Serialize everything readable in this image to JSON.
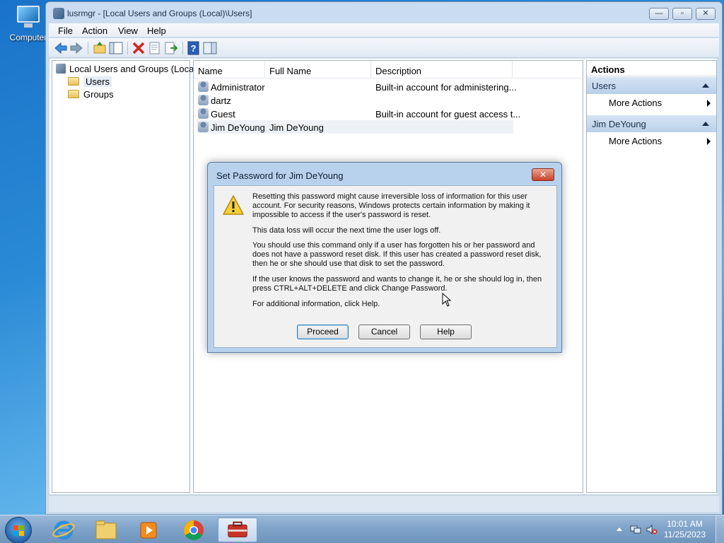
{
  "desktop": {
    "icon_label": "Computer"
  },
  "window": {
    "title": "lusrmgr - [Local Users and Groups (Local)\\Users]",
    "controls": {
      "minimize": "—",
      "maximize": "▫",
      "close": "✕"
    },
    "menu": [
      "File",
      "Action",
      "View",
      "Help"
    ]
  },
  "tree": {
    "root": "Local Users and Groups (Local)",
    "users": "Users",
    "groups": "Groups"
  },
  "list": {
    "columns": [
      "Name",
      "Full Name",
      "Description"
    ],
    "rows": [
      {
        "name": "Administrator",
        "full_name": "",
        "description": "Built-in account for administering..."
      },
      {
        "name": "dartz",
        "full_name": "",
        "description": ""
      },
      {
        "name": "Guest",
        "full_name": "",
        "description": "Built-in account for guest access t..."
      },
      {
        "name": "Jim DeYoung",
        "full_name": "Jim DeYoung",
        "description": ""
      }
    ]
  },
  "actions": {
    "header": "Actions",
    "section1": "Users",
    "section1_item": "More Actions",
    "section2": "Jim DeYoung",
    "section2_item": "More Actions"
  },
  "dialog": {
    "title": "Set Password for Jim DeYoung",
    "close": "✕",
    "p1": "Resetting this password might cause irreversible loss of information for this user account. For security reasons, Windows protects certain information by making it impossible to access if the user's password is reset.",
    "p2": "This data loss will occur the next time the user logs off.",
    "p3": "You should use this command only if a user has forgotten his or her password and does not have a password reset disk. If this user has created a password reset disk, then he or she should use that disk to set the password.",
    "p4": "If the user knows the password and wants to change it, he or she should log in, then press CTRL+ALT+DELETE and click Change Password.",
    "p5": "For additional information, click Help.",
    "buttons": {
      "proceed": "Proceed",
      "cancel": "Cancel",
      "help": "Help"
    }
  },
  "taskbar": {
    "time": "10:01 AM",
    "date": "11/25/2023"
  }
}
